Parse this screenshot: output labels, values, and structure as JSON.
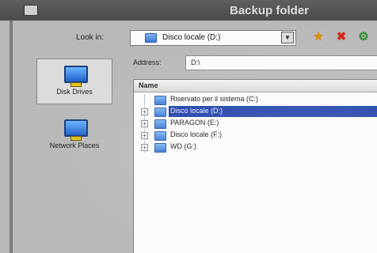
{
  "window": {
    "title": "Backup folder"
  },
  "toolbar": {
    "look_in_label": "Look in:",
    "look_in_value": "Disco locale (D:)",
    "dropdown_icon": "chevron-down-icon",
    "buttons": [
      {
        "name": "new-folder",
        "icon": "folder-star-icon"
      },
      {
        "name": "delete",
        "icon": "close-icon"
      },
      {
        "name": "more",
        "icon": "tool-icon"
      }
    ]
  },
  "places": [
    {
      "label": "Disk Drives",
      "icon": "computer-icon",
      "selected": true
    },
    {
      "label": "Network Places",
      "icon": "network-icon",
      "selected": false
    }
  ],
  "address": {
    "label": "Address:",
    "value": "D:\\"
  },
  "tree": {
    "header": "Name",
    "rows": [
      {
        "label": "Riservato per il sistema (C:)",
        "expandable": false,
        "selected": false
      },
      {
        "label": "Disco locale (D:)",
        "expandable": true,
        "selected": true
      },
      {
        "label": "PARAGON (E:)",
        "expandable": true,
        "selected": false
      },
      {
        "label": "Disco locale (F:)",
        "expandable": true,
        "selected": false
      },
      {
        "label": "WD (G:)",
        "expandable": true,
        "selected": false
      }
    ]
  },
  "colors": {
    "selection": "#1d3fa8",
    "window_bg": "#b9b9b9",
    "titlebar": "#4a4a4a"
  }
}
